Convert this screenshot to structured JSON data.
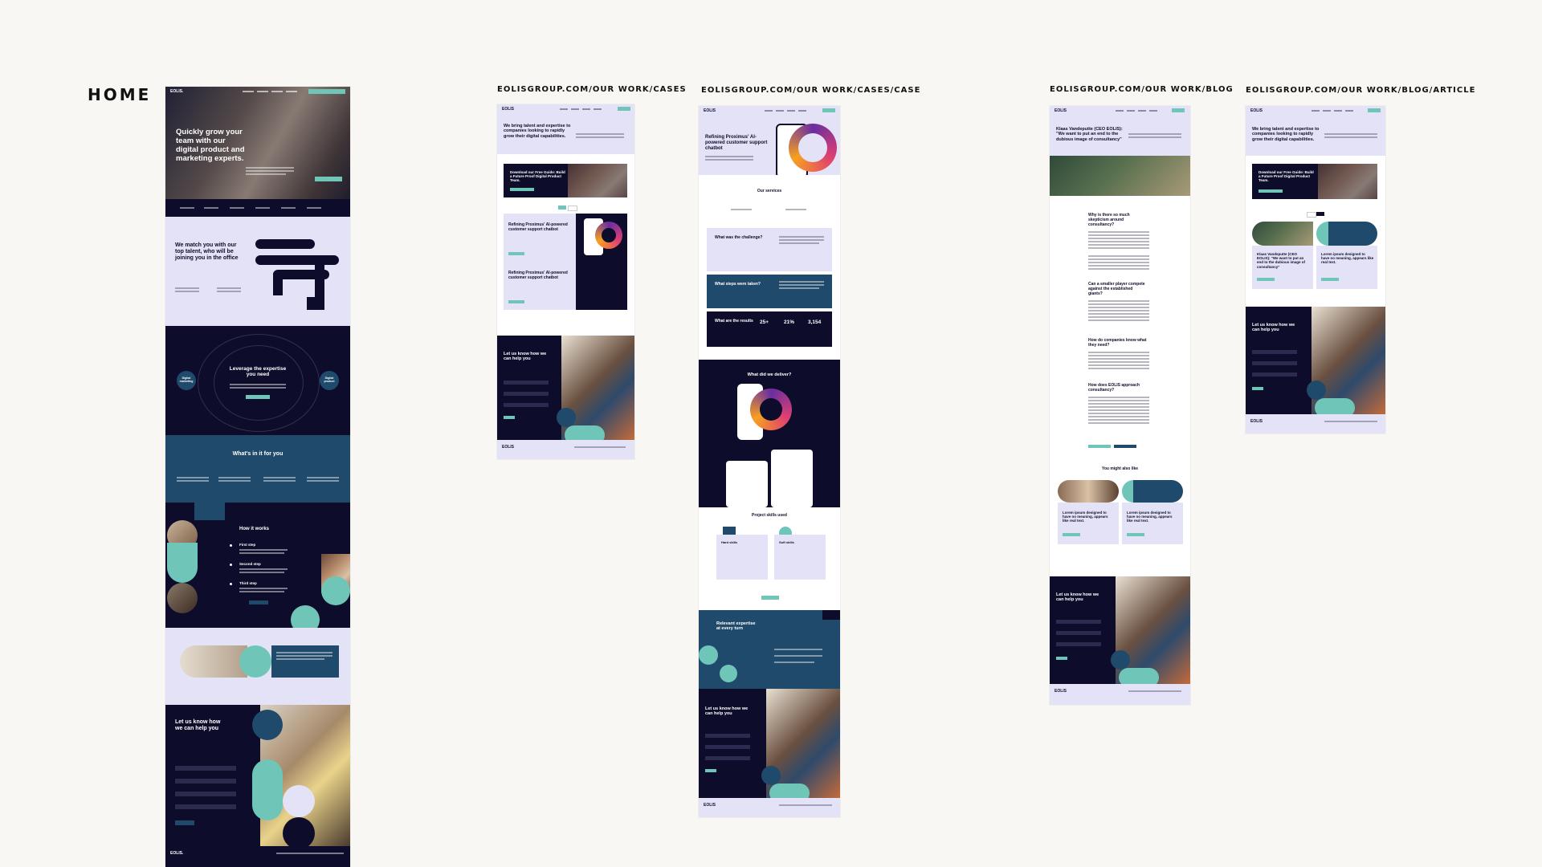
{
  "labels": {
    "home": "HOME",
    "cases": "EOLISGROUP.COM/OUR WORK/CASES",
    "case": "EOLISGROUP.COM/OUR WORK/CASES/CASE",
    "blog": "EOLISGROUP.COM/OUR WORK/BLOG",
    "article": "EOLISGROUP.COM/OUR WORK/BLOG/ARTICLE"
  },
  "home": {
    "logo": "EOLIS.",
    "hero": "Quickly grow your team with our digital product and marketing experts.",
    "match": "We match you with our top talent, who will be joining you in the office",
    "leverage": "Leverage the expertise you need",
    "orbit_left": "Digital marketing",
    "orbit_right": "Digital product",
    "whats_in": "What's in it for you",
    "how": "How it works",
    "step1": "First step",
    "step2": "Second step",
    "step3": "Third step",
    "contact": "Let us know how we can help you",
    "footer_logo": "EOLIS."
  },
  "cases": {
    "logo": "EOLIS",
    "hero": "We bring talent and expertise to companies looking to rapidly grow their digital capabilities.",
    "guide": "Download our Free Guide: Build a Future Proof Digital Product Team.",
    "card1": "Refining Proximus' AI-powered customer support chatbot",
    "card2": "Refining Proximus' AI-powered customer support chatbot",
    "contact": "Let us know how we can help you",
    "footer_logo": "EOLIS"
  },
  "case": {
    "logo": "EOLIS",
    "hero": "Refining Proximus' AI-powered customer support chatbot",
    "services": "Our services",
    "challenge": "What was the challenge?",
    "steps": "What steps were taken?",
    "results": "What are the results",
    "stat1": "25+",
    "stat2": "21%",
    "stat3": "3,154",
    "deliver": "What did we deliver?",
    "skills": "Project skills used",
    "hard": "Hard skills",
    "soft": "Soft skills",
    "relevant": "Relevant expertise at every turn",
    "contact": "Let us know how we can help you",
    "footer_logo": "EOLIS"
  },
  "blog": {
    "logo": "EOLIS",
    "hero": "Klaas Vandeputte (CEO EOLIS): \"We want to put an end to the dubious image of consultancy\"",
    "q1": "Why is there so much skepticism around consultancy?",
    "q2": "Can a smaller player compete against the established giants?",
    "q3": "How do companies know what they need?",
    "q4": "How does EOLIS approach consultancy?",
    "also": "You might also like",
    "rel1": "Lorem ipsum designed to have no meaning, appears like real text.",
    "rel2": "Lorem ipsum designed to have no meaning, appears like real text.",
    "contact": "Let us know how we can help you",
    "footer_logo": "EOLIS"
  },
  "article": {
    "logo": "EOLIS",
    "hero": "We bring talent and expertise to companies looking to rapidly grow their digital capabilities.",
    "guide": "Download our Free Guide: Build a Future Proof Digital Product Team.",
    "card1": "Klaas Vandeputte (CEO EOLIS): \"We want to put an end to the dubious image of consultancy\"",
    "card2": "Lorem ipsum designed to have no meaning, appears like real text.",
    "contact": "Let us know how we can help you",
    "footer_logo": "EOLIS"
  },
  "colors": {
    "navy": "#0d0d2b",
    "lavender": "#e4e2f7",
    "teal": "#6fc6b8",
    "blue": "#1f4a6b",
    "background": "#f8f7f4"
  }
}
